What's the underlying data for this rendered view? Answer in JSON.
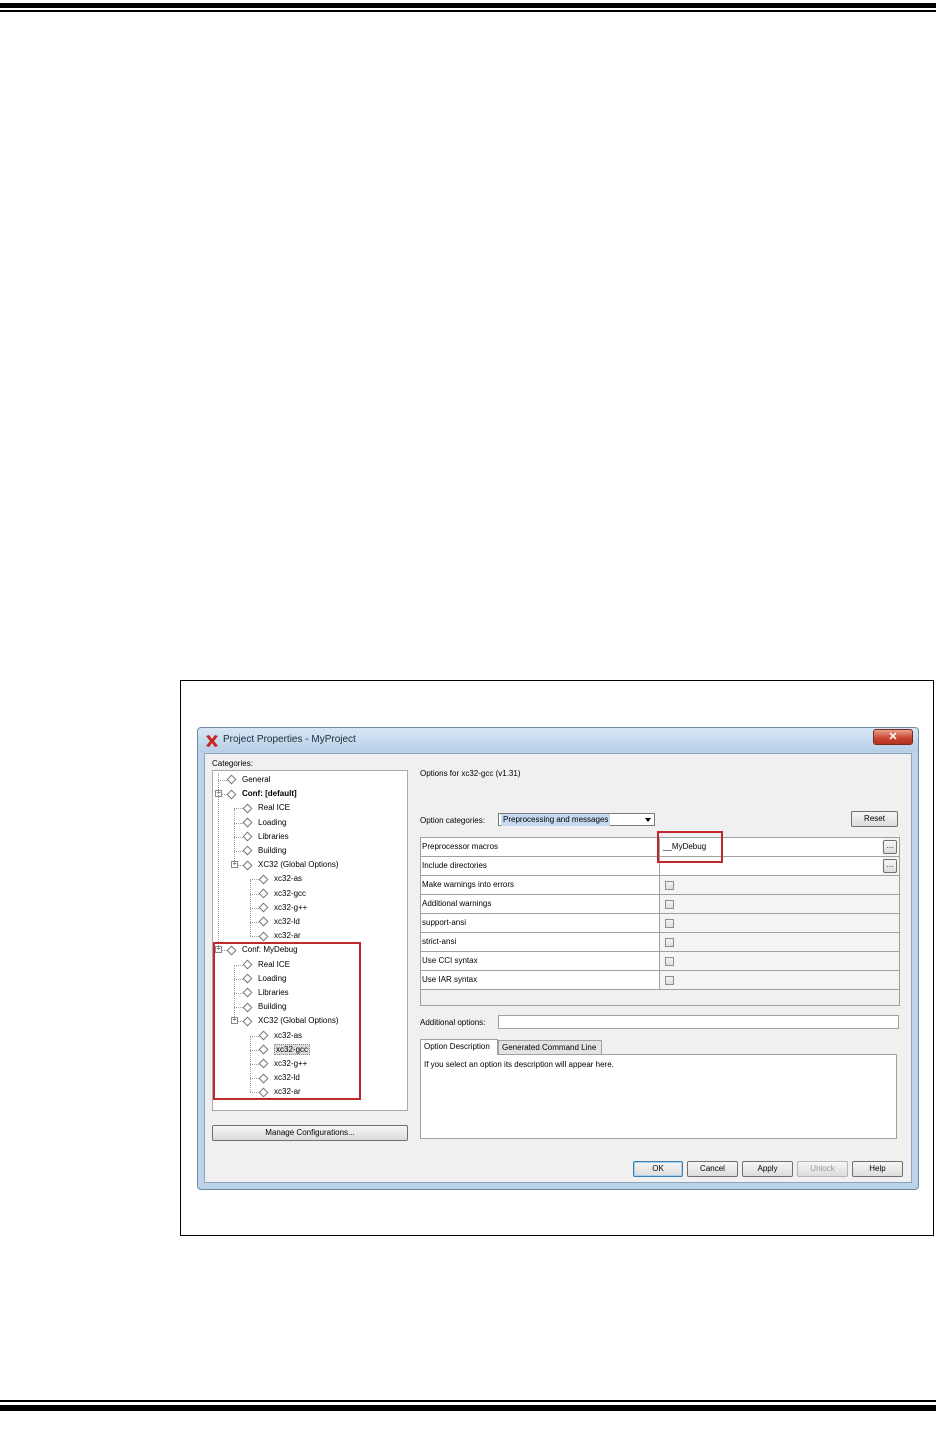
{
  "window": {
    "title": "Project Properties - MyProject",
    "close_glyph": "✕",
    "app_icon": "x-logo-icon"
  },
  "categories": {
    "label": "Categories:",
    "tree": [
      {
        "label": "General",
        "level": 0
      },
      {
        "label": "Conf: [default]",
        "level": 0,
        "expanded": true,
        "bold": true
      },
      {
        "label": "Real ICE",
        "level": 1
      },
      {
        "label": "Loading",
        "level": 1
      },
      {
        "label": "Libraries",
        "level": 1
      },
      {
        "label": "Building",
        "level": 1
      },
      {
        "label": "XC32 (Global Options)",
        "level": 1,
        "expanded": true
      },
      {
        "label": "xc32-as",
        "level": 2
      },
      {
        "label": "xc32-gcc",
        "level": 2
      },
      {
        "label": "xc32-g++",
        "level": 2
      },
      {
        "label": "xc32-ld",
        "level": 2
      },
      {
        "label": "xc32-ar",
        "level": 2
      },
      {
        "label": "Conf: MyDebug",
        "level": 0,
        "expanded": true
      },
      {
        "label": "Real ICE",
        "level": 1
      },
      {
        "label": "Loading",
        "level": 1
      },
      {
        "label": "Libraries",
        "level": 1
      },
      {
        "label": "Building",
        "level": 1
      },
      {
        "label": "XC32 (Global Options)",
        "level": 1,
        "expanded": true
      },
      {
        "label": "xc32-as",
        "level": 2
      },
      {
        "label": "xc32-gcc",
        "level": 2,
        "selected": true
      },
      {
        "label": "xc32-g++",
        "level": 2
      },
      {
        "label": "xc32-ld",
        "level": 2
      },
      {
        "label": "xc32-ar",
        "level": 2
      }
    ],
    "manage_button": "Manage Configurations..."
  },
  "options": {
    "header": "Options for xc32-gcc (v1.31)",
    "category_label": "Option categories:",
    "category_value": "Preprocessing and messages",
    "reset_button": "Reset",
    "rows": [
      {
        "name": "Preprocessor macros",
        "type": "text",
        "value": "__MyDebug",
        "button": "..."
      },
      {
        "name": "Include directories",
        "type": "text",
        "value": "",
        "button": "..."
      },
      {
        "name": "Make warnings into errors",
        "type": "check",
        "checked": false
      },
      {
        "name": "Additional warnings",
        "type": "check",
        "checked": false
      },
      {
        "name": "support-ansi",
        "type": "check",
        "checked": false
      },
      {
        "name": "strict-ansi",
        "type": "check",
        "checked": false
      },
      {
        "name": "Use CCI syntax",
        "type": "check",
        "checked": false
      },
      {
        "name": "Use IAR syntax",
        "type": "check",
        "checked": false
      }
    ],
    "additional_label": "Additional options:",
    "additional_value": "",
    "tabs": [
      {
        "label": "Option Description",
        "active": true
      },
      {
        "label": "Generated Command Line",
        "active": false
      }
    ],
    "description": "If you select an option its description will appear here."
  },
  "buttons": {
    "ok": "OK",
    "cancel": "Cancel",
    "apply": "Apply",
    "unlock": "Unlock",
    "help": "Help"
  },
  "colors": {
    "highlight_box": "#c0282e",
    "window_frame": "#bcd3ea"
  }
}
